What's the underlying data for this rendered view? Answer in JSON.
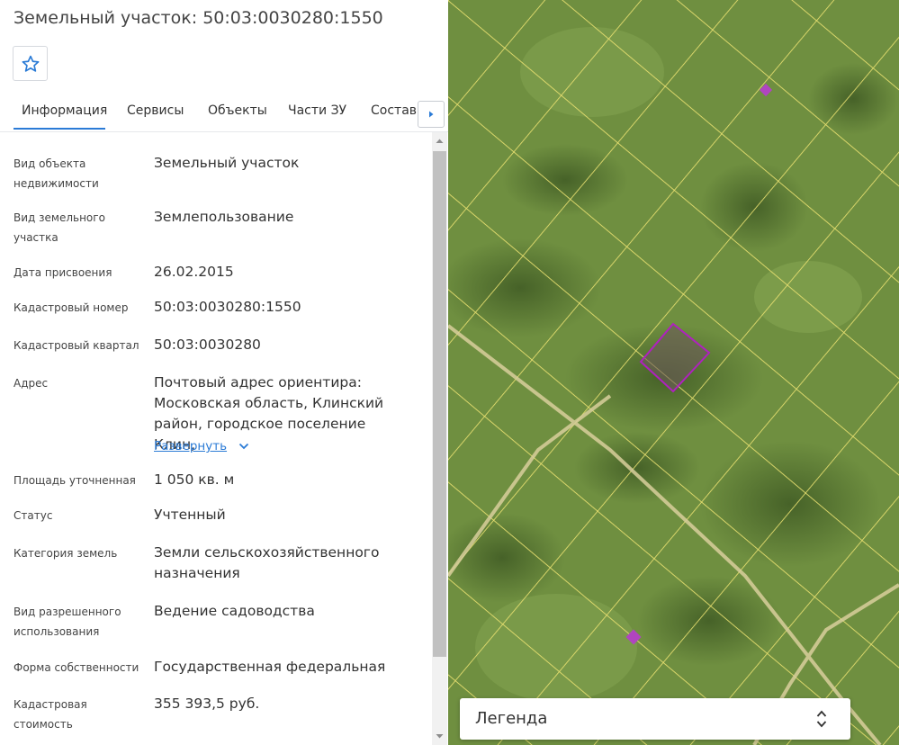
{
  "header": {
    "title": "Земельный участок: 50:03:0030280:1550"
  },
  "favorite": {
    "icon": "star-outline-icon"
  },
  "tabs": [
    {
      "label": "Информация",
      "active": true
    },
    {
      "label": "Сервисы"
    },
    {
      "label": "Объекты"
    },
    {
      "label": "Части ЗУ"
    },
    {
      "label": "Состав"
    }
  ],
  "tab_next_icon": "chevron-right-icon",
  "properties": [
    {
      "label": "Вид объекта недвижимости",
      "value": "Земельный участок"
    },
    {
      "label": "Вид земельного участка",
      "value": "Землепользование"
    },
    {
      "label": "Дата присвоения",
      "value": "26.02.2015"
    },
    {
      "label": "Кадастровый номер",
      "value": "50:03:0030280:1550"
    },
    {
      "label": "Кадастровый квартал",
      "value": "50:03:0030280"
    },
    {
      "label": "Адрес",
      "value": "Почтовый адрес ориентира: Московская область, Клинский район, городское поселение Клин,",
      "link": "Развернуть"
    },
    {
      "label": "Площадь уточненная",
      "value": "1 050 кв. м"
    },
    {
      "label": "Статус",
      "value": "Учтенный"
    },
    {
      "label": "Категория земель",
      "value": "Земли сельскохозяйственного назначения"
    },
    {
      "label": "Вид разрешенного использования",
      "value": "Ведение садоводства"
    },
    {
      "label": "Форма собственности",
      "value": "Государственная федеральная"
    },
    {
      "label": "Кадастровая стоимость",
      "value": "355 393,5 руб."
    }
  ],
  "legend": {
    "label": "Легенда",
    "icon": "expand-toggle-icon"
  },
  "colors": {
    "accent": "#2b7bd6",
    "parcel_lines": "#e8e070",
    "selected_parcel": "#b020c0"
  }
}
